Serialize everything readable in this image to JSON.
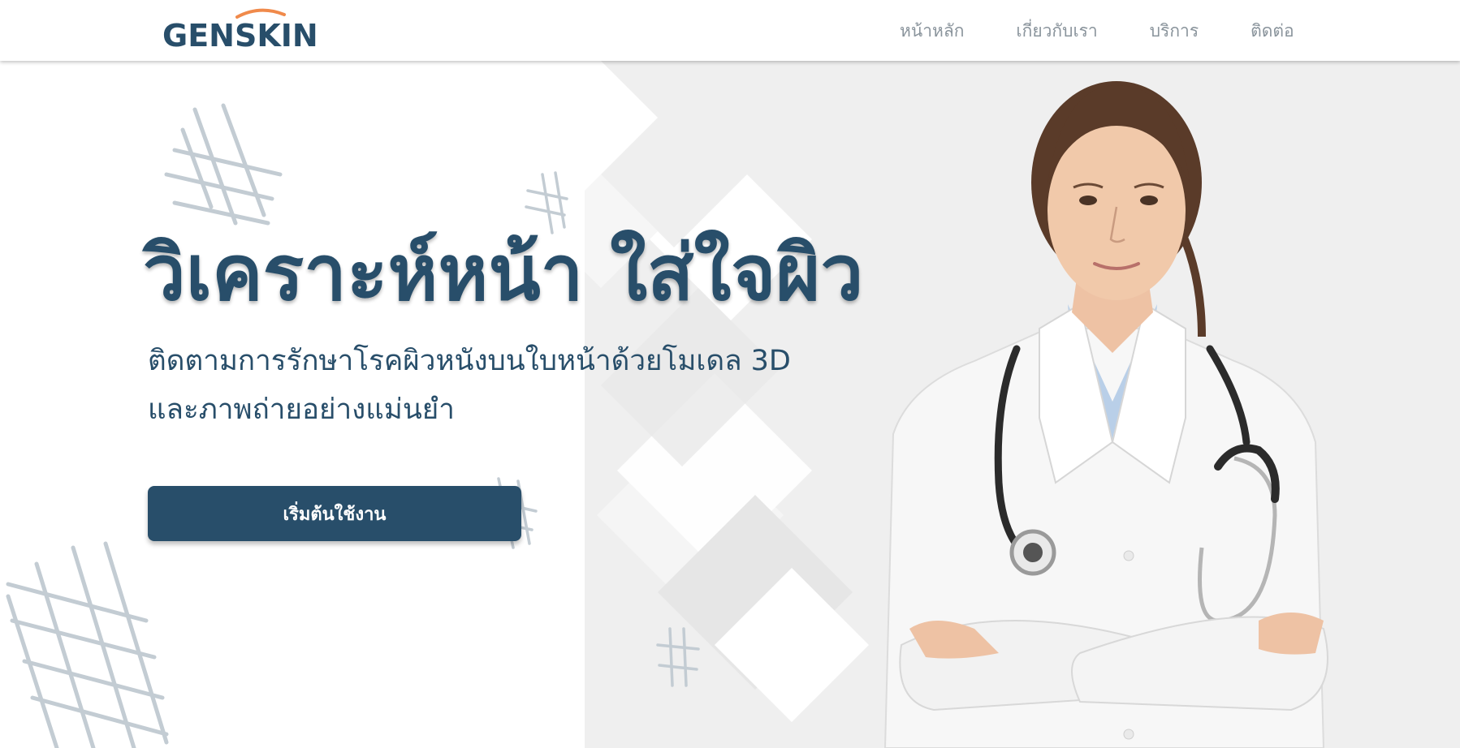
{
  "brand": {
    "name": "GENSKIN",
    "accent_color": "#f08a4b",
    "primary_color": "#284e6a"
  },
  "nav": {
    "items": [
      {
        "label": "หน้าหลัก"
      },
      {
        "label": "เกี่ยวกับเรา"
      },
      {
        "label": "บริการ"
      },
      {
        "label": "ติดต่อ"
      }
    ]
  },
  "hero": {
    "title": "วิเคราะห์หน้า ใส่ใจผิว",
    "subtitle_line1": "ติดตามการรักษาโรคผิวหนังบนใบหน้าด้วยโมเดล 3D",
    "subtitle_line2": "และภาพถ่ายอย่างแม่นยำ",
    "cta_label": "เริ่มต้นใช้งาน",
    "image": "doctor-portrait-with-stethoscope"
  }
}
